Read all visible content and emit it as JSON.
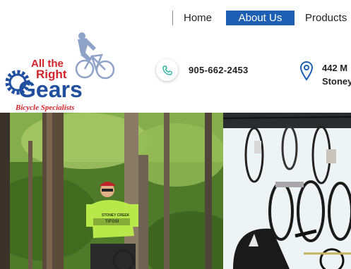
{
  "nav": {
    "items": [
      {
        "label": "Home",
        "active": false
      },
      {
        "label": "About Us",
        "active": true
      },
      {
        "label": "Products",
        "active": false
      }
    ]
  },
  "logo": {
    "line1": "All the",
    "line2": "Right",
    "line3": "Gears",
    "tagline": "Bicycle Specialists"
  },
  "contact": {
    "phone": "905-662-2453",
    "address_line1": "442  M",
    "address_line2": "Stoney"
  },
  "jersey": {
    "line1": "STONEY CREEK",
    "line2": "TIFOSI"
  },
  "colors": {
    "nav_active": "#1d5fb3",
    "logo_red": "#d2232a",
    "logo_blue": "#1f4f9e",
    "phone_icon": "#2bb3a3",
    "pin_icon": "#1d5fb3"
  }
}
